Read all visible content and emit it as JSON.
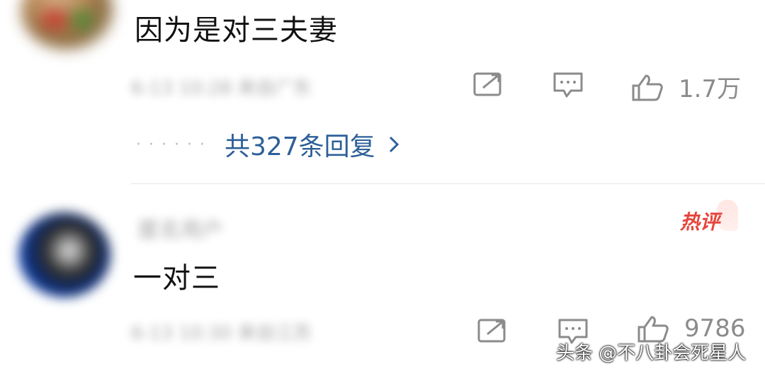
{
  "comments": [
    {
      "text": "因为是对三夫妻",
      "meta_blurred": "6-13 10:28 来自广东",
      "replies_label": "共327条回复",
      "likes": "1.7万"
    },
    {
      "author_blurred": "匿名用户",
      "badge": "热评",
      "text": "一对三",
      "meta_blurred": "6-13 10:30 来自江苏",
      "likes": "9786"
    }
  ],
  "watermark": "头条 @不八卦会死星人",
  "icons": {
    "share": "share-icon",
    "comment": "comment-icon",
    "like": "thumb-up-icon",
    "replies_arrow": "chevron-right-icon",
    "dots": "ellipsis-icon"
  },
  "colors": {
    "link": "#2d5f99",
    "muted": "#8b8b8b",
    "badge": "#e6453c"
  }
}
